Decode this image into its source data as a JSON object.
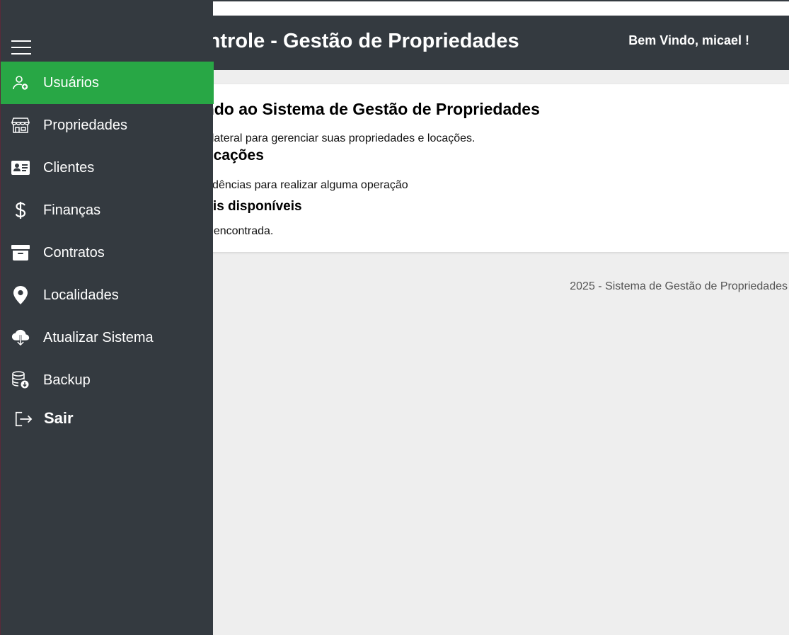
{
  "header": {
    "title": "Controle - Gestão de Propriedades",
    "welcome": "Bem Vindo, micael !"
  },
  "main": {
    "heading": "Bem-vindo ao Sistema de Gestão de Propriedades",
    "intro": "Utilize o menu lateral para gerenciar suas propriedades e locações.",
    "section_title": "Notificações",
    "section_text": "Sem pendências para realizar alguma operação",
    "subsection_title": "Imóveis disponíveis",
    "subsection_text": "Nenhuma encontrada."
  },
  "footer": {
    "text": "2025 - Sistema de Gestão de Propriedades"
  },
  "sidebar": {
    "items": [
      {
        "label": "Usuários",
        "icon": "user-plus-icon",
        "active": true
      },
      {
        "label": "Propriedades",
        "icon": "shop-icon",
        "active": false
      },
      {
        "label": "Clientes",
        "icon": "id-card-icon",
        "active": false
      },
      {
        "label": "Finanças",
        "icon": "dollar-icon",
        "active": false
      },
      {
        "label": "Contratos",
        "icon": "archive-icon",
        "active": false
      },
      {
        "label": "Localidades",
        "icon": "location-pin-icon",
        "active": false
      },
      {
        "label": "Atualizar Sistema",
        "icon": "cloud-download-icon",
        "active": false
      },
      {
        "label": "Backup",
        "icon": "database-download-icon",
        "active": false
      }
    ],
    "logout_label": "Sair"
  },
  "colors": {
    "sidebar_bg": "#343a40",
    "active_item": "#28a745",
    "page_bg": "#eeeeee"
  }
}
